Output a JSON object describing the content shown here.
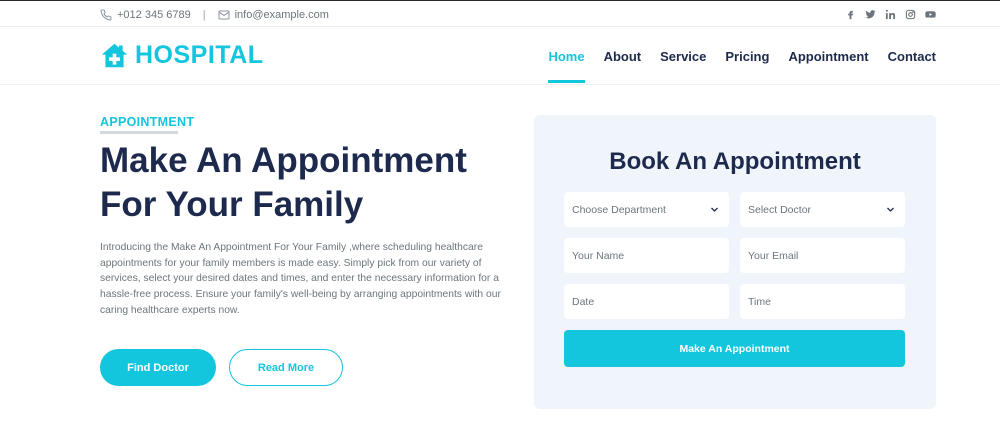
{
  "topbar": {
    "phone": "+012 345 6789",
    "separator": "|",
    "email": "info@example.com",
    "social_icons": [
      "facebook-icon",
      "twitter-icon",
      "linkedin-icon",
      "instagram-icon",
      "youtube-icon"
    ]
  },
  "brand": {
    "name": "HOSPITAL",
    "accent_color": "#13c5dd",
    "dark_color": "#1d2a4d"
  },
  "nav": {
    "items": [
      {
        "label": "Home",
        "active": true
      },
      {
        "label": "About",
        "active": false
      },
      {
        "label": "Service",
        "active": false
      },
      {
        "label": "Pricing",
        "active": false
      },
      {
        "label": "Appointment",
        "active": false
      },
      {
        "label": "Contact",
        "active": false
      }
    ]
  },
  "hero": {
    "eyebrow": "APPOINTMENT",
    "headline": "Make An Appointment For Your Family",
    "description": "Introducing the Make An Appointment For Your Family ,where scheduling healthcare appointments for your family members is made easy. Simply pick from our variety of services, select your desired dates and times, and enter the necessary information for a hassle-free process. Ensure your family's well-being by arranging appointments with our caring healthcare experts now.",
    "primary_button": "Find Doctor",
    "secondary_button": "Read More"
  },
  "booking": {
    "title": "Book An Appointment",
    "department_select": "Choose Department",
    "doctor_select": "Select Doctor",
    "name_placeholder": "Your Name",
    "email_placeholder": "Your Email",
    "date_placeholder": "Date",
    "time_placeholder": "Time",
    "submit_label": "Make An Appointment"
  }
}
